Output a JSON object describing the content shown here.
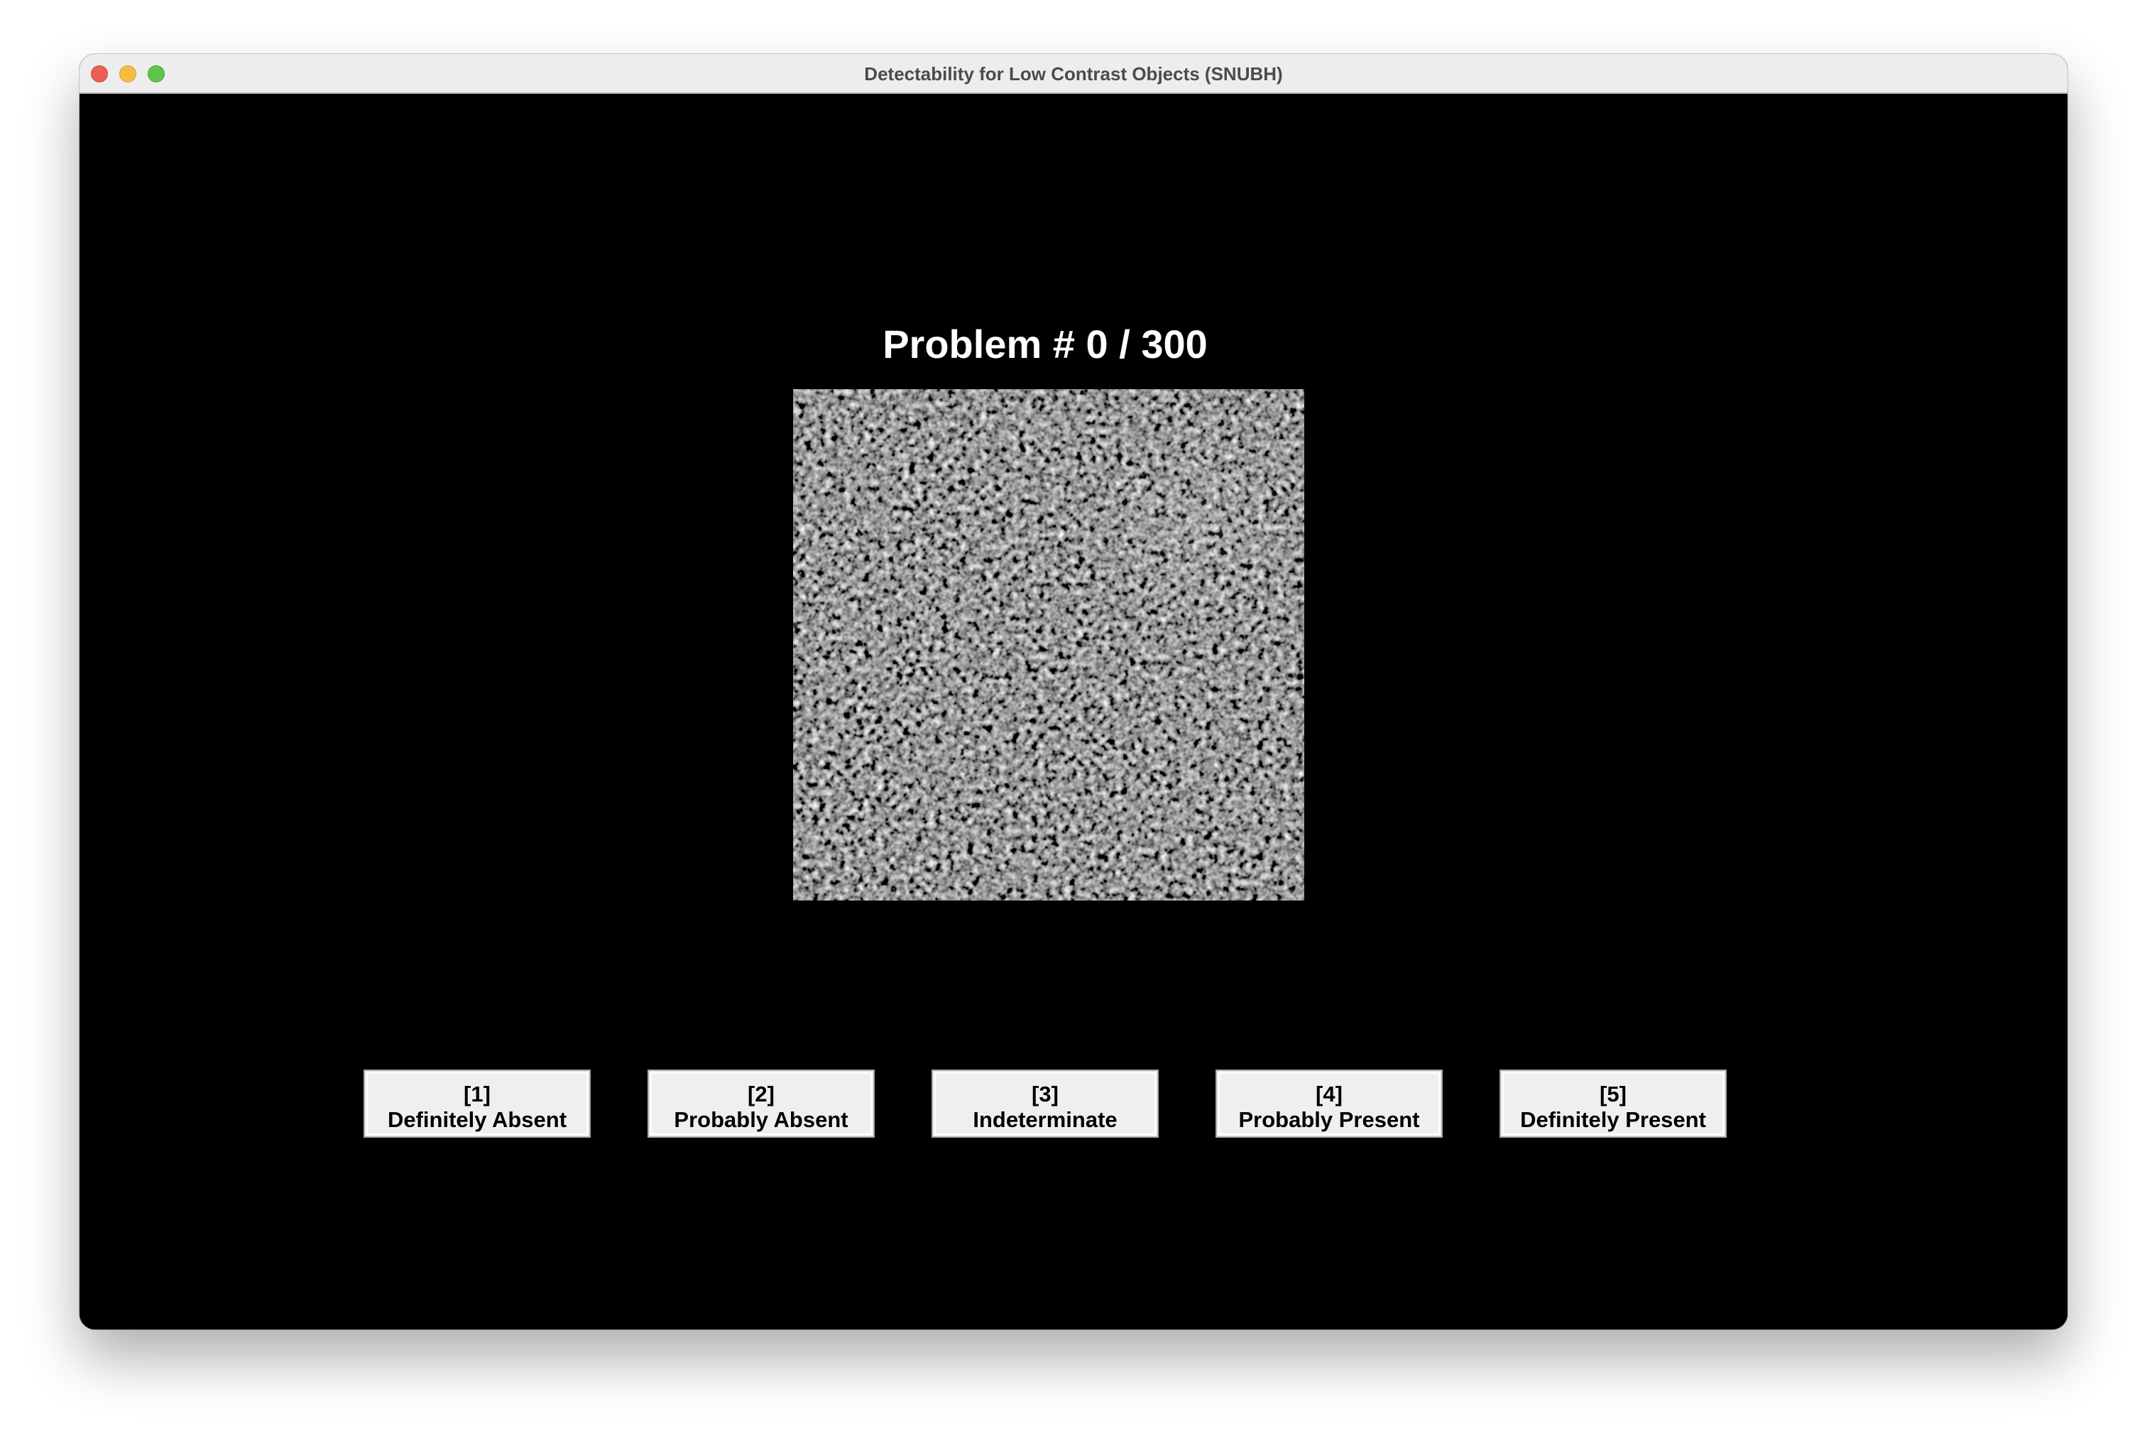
{
  "window": {
    "title": "Detectability for Low Contrast Objects (SNUBH)"
  },
  "main": {
    "problem_label": "Problem # 0 / 300"
  },
  "buttons": [
    {
      "key": "[1]",
      "label": "Definitely Absent"
    },
    {
      "key": "[2]",
      "label": "Probably Absent"
    },
    {
      "key": "[3]",
      "label": "Indeterminate"
    },
    {
      "key": "[4]",
      "label": "Probably Present"
    },
    {
      "key": "[5]",
      "label": "Definitely Present"
    }
  ],
  "colors": {
    "background": "#000000",
    "button_face": "#efefef",
    "traffic_close": "#ee5e57",
    "traffic_minimize": "#f4bd3f",
    "traffic_zoom": "#5ec54a"
  }
}
